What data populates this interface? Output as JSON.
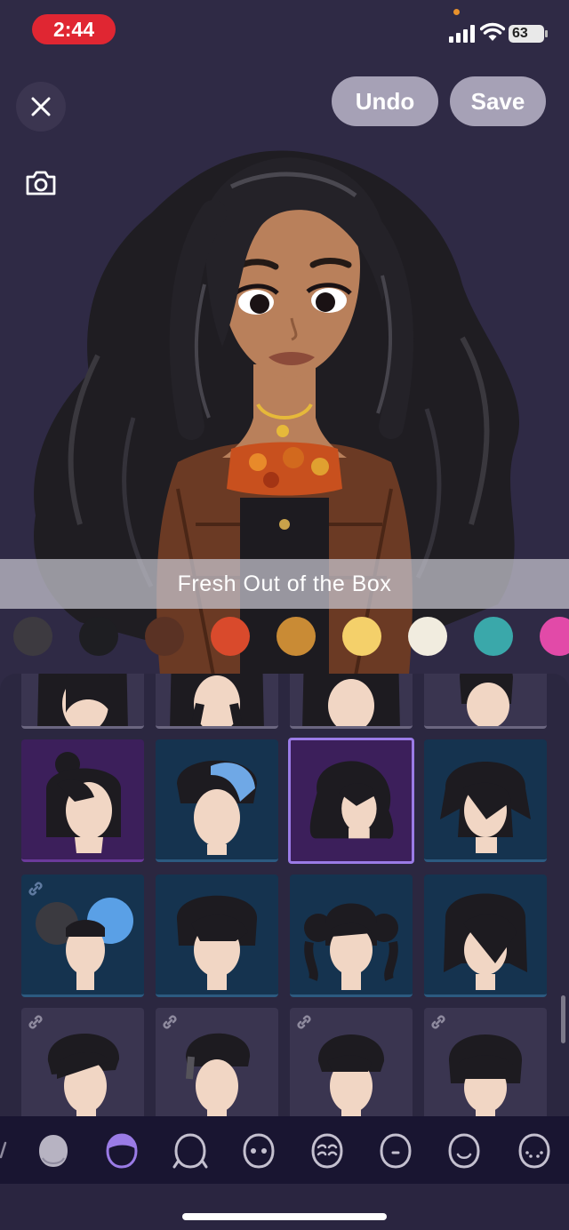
{
  "status_bar": {
    "time": "2:44",
    "battery": "63",
    "icons": [
      "signal-icon",
      "wifi-icon",
      "battery-icon"
    ]
  },
  "header": {
    "close_icon": "close-icon",
    "camera_icon": "camera-icon",
    "undo_label": "Undo",
    "save_label": "Save"
  },
  "hairstyle_name": "Fresh Out of the Box",
  "color_swatches": [
    {
      "name": "charcoal",
      "color": "#3d3a40"
    },
    {
      "name": "black",
      "color": "#1e1e22"
    },
    {
      "name": "brown",
      "color": "#5a3224"
    },
    {
      "name": "red",
      "color": "#d94a2c"
    },
    {
      "name": "gold-brown",
      "color": "#c98b35"
    },
    {
      "name": "yellow",
      "color": "#f4d06a"
    },
    {
      "name": "cream",
      "color": "#f1ecdf"
    },
    {
      "name": "teal",
      "color": "#3aa8aa"
    },
    {
      "name": "pink",
      "color": "#e24aa8"
    }
  ],
  "hair_grid": {
    "rows": [
      [
        {
          "style": "gray",
          "hair": "long-dark",
          "locked": false
        },
        {
          "style": "gray",
          "hair": "long-dark",
          "locked": false
        },
        {
          "style": "gray",
          "hair": "long-dark",
          "locked": false
        },
        {
          "style": "gray",
          "hair": "short-dark",
          "locked": false
        }
      ],
      [
        {
          "style": "purple",
          "hair": "bun-bob",
          "locked": false
        },
        {
          "style": "blue",
          "hair": "blue-streak",
          "locked": false
        },
        {
          "style": "selected",
          "hair": "long-wavy",
          "locked": false
        },
        {
          "style": "blue",
          "hair": "shaggy",
          "locked": false
        }
      ],
      [
        {
          "style": "blue",
          "hair": "curly-blue",
          "locked": true
        },
        {
          "style": "blue",
          "hair": "messy-short",
          "locked": false
        },
        {
          "style": "blue",
          "hair": "pigtails",
          "locked": false
        },
        {
          "style": "blue",
          "hair": "wolf-cut",
          "locked": false
        }
      ],
      [
        {
          "style": "gray",
          "hair": "side-swept",
          "locked": true
        },
        {
          "style": "gray",
          "hair": "undercut",
          "locked": true
        },
        {
          "style": "gray",
          "hair": "short-fringe",
          "locked": true
        },
        {
          "style": "gray",
          "hair": "mushroom",
          "locked": true
        }
      ]
    ]
  },
  "categories": [
    {
      "name": "head-icon",
      "active": false
    },
    {
      "name": "hair-icon",
      "active": true
    },
    {
      "name": "head-outline-icon",
      "active": false
    },
    {
      "name": "eyes-icon",
      "active": false
    },
    {
      "name": "eyebrows-icon",
      "active": false
    },
    {
      "name": "nose-icon",
      "active": false
    },
    {
      "name": "mouth-icon",
      "active": false
    },
    {
      "name": "freckles-icon",
      "active": false
    }
  ],
  "colors": {
    "accent": "#9a7be6",
    "background": "#2f2a45",
    "time_pill": "#e02632"
  }
}
